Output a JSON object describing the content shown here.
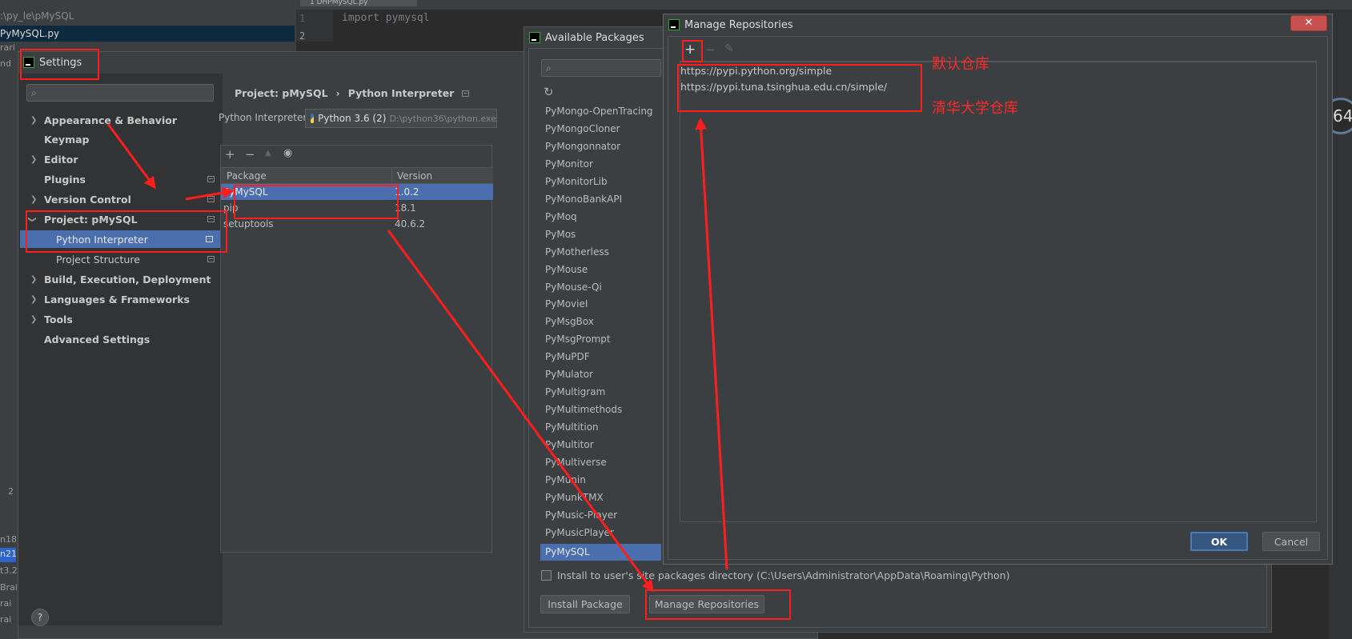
{
  "editor": {
    "path": ":\\py_le\\pMySQL",
    "file_tab": "PyMySQL.py",
    "editor_tab": "1 DHPMySQL.py",
    "line_numbers": [
      "1",
      "2"
    ],
    "code_line": "import pymysql",
    "left_fragments": [
      "rari",
      "nd",
      "2",
      "n18",
      "n21",
      "t3.2",
      "Brai",
      "rai",
      "rai"
    ],
    "circle_value": "64"
  },
  "settings": {
    "title": "Settings",
    "search_placeholder": "",
    "nav": [
      {
        "label": "Appearance & Behavior",
        "expandable": true
      },
      {
        "label": "Keymap",
        "expandable": false
      },
      {
        "label": "Editor",
        "expandable": true
      },
      {
        "label": "Plugins",
        "expandable": false
      },
      {
        "label": "Version Control",
        "expandable": true
      },
      {
        "label": "Project: pMySQL",
        "expandable": true
      },
      {
        "label": "Python Interpreter",
        "expandable": false
      },
      {
        "label": "Project Structure",
        "expandable": false
      },
      {
        "label": "Build, Execution, Deployment",
        "expandable": true
      },
      {
        "label": "Languages & Frameworks",
        "expandable": true
      },
      {
        "label": "Tools",
        "expandable": true
      },
      {
        "label": "Advanced Settings",
        "expandable": false
      }
    ],
    "breadcrumb_project": "Project: pMySQL",
    "breadcrumb_sep": "›",
    "breadcrumb_page": "Python Interpreter",
    "interpreter_label": "Python Interpreter:",
    "interpreter_value": "Python 3.6 (2)",
    "interpreter_path": "D:\\python36\\python.exe",
    "toolbar": {
      "add": "+",
      "remove": "−",
      "up": "▲",
      "show": "◉"
    },
    "table_headers": [
      "Package",
      "Version"
    ],
    "packages": [
      {
        "name": "PyMySQL",
        "version": "1.0.2"
      },
      {
        "name": "pip",
        "version": "18.1"
      },
      {
        "name": "setuptools",
        "version": "40.6.2"
      }
    ],
    "help": "?"
  },
  "available": {
    "title": "Available Packages",
    "refresh": "↻",
    "packages": [
      "PyMongo-OpenTracing",
      "PyMongoCloner",
      "PyMongonnator",
      "PyMonitor",
      "PyMonitorLib",
      "PyMonoBankAPI",
      "PyMoq",
      "PyMos",
      "PyMotherless",
      "PyMouse",
      "PyMouse-Qi",
      "PyMovieI",
      "PyMsgBox",
      "PyMsgPrompt",
      "PyMuPDF",
      "PyMulator",
      "PyMultigram",
      "PyMultimethods",
      "PyMultition",
      "PyMultitor",
      "PyMultiverse",
      "PyMunin",
      "PyMunkTMX",
      "PyMusic-Player",
      "PyMusicPlayer",
      "PyMySQL"
    ],
    "install_user_label": "Install to user's site packages directory (C:\\Users\\Administrator\\AppData\\Roaming\\Python)",
    "install_button": "Install Package",
    "manage_button": "Manage Repositories"
  },
  "repos": {
    "title": "Manage Repositories",
    "close": "✕",
    "add": "+",
    "remove": "−",
    "edit": "✎",
    "urls": [
      "https://pypi.python.org/simple",
      "https://pypi.tuna.tsinghua.edu.cn/simple/"
    ],
    "ok": "OK",
    "cancel": "Cancel"
  },
  "annotations": {
    "default_repo": "默认仓库",
    "tsinghua_repo": "清华大学仓库"
  }
}
